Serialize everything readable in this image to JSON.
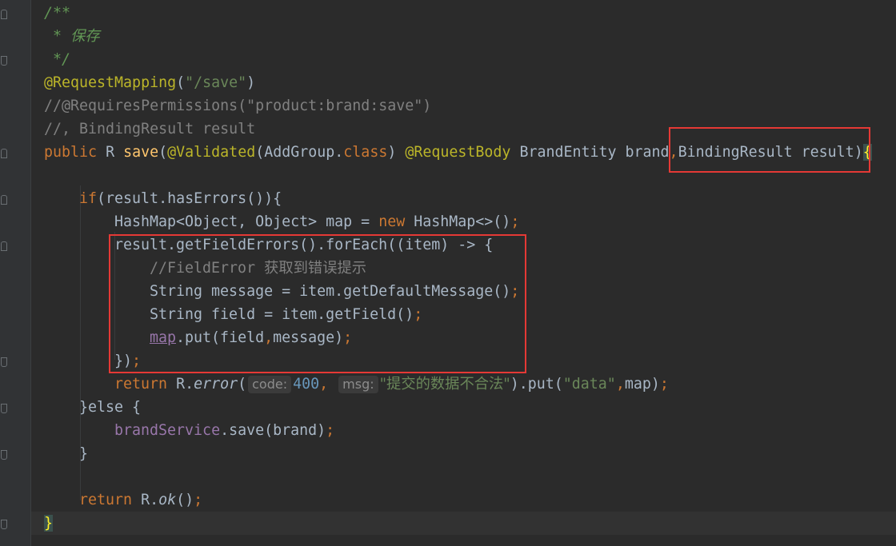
{
  "code": {
    "doc_open": "/**",
    "doc_text": " * 保存",
    "doc_close": " */",
    "ann_mapping": "@RequestMapping",
    "mapping_path": "\"/save\"",
    "comment_perms": "//@RequiresPermissions(\"product:brand:save\")",
    "comment_binding": "//, BindingResult result",
    "kw_public": "public",
    "type_r": "R",
    "method_save": "save",
    "ann_validated": "@Validated",
    "addgroup": "AddGroup",
    "kw_class": "class",
    "ann_requestbody": "@RequestBody",
    "brand_param": "BrandEntity brand",
    "binding_param": "BindingResult result",
    "kw_if": "if",
    "cond": "result.hasErrors()",
    "hashmap_decl": "HashMap<Object, Object> map = ",
    "kw_new": "new",
    "hashmap_ctor": "HashMap<>()",
    "foreach_line": "result.getFieldErrors().forEach((item) -> {",
    "comment_fielderror": "//FieldError 获取到错误提示",
    "message_line": "String message = item.getDefaultMessage()",
    "field_line": "String field = item.getField()",
    "map_var": "map",
    "put_call": ".put(field",
    "put_arg2": "message)",
    "close_lambda": "})",
    "kw_return": "return",
    "r_prefix": "R.",
    "error_fn": "error",
    "hint_code": "code:",
    "num_400": "400",
    "hint_msg": "msg:",
    "msg_str": "\"提交的数据不合法\"",
    "put_data": ").put(",
    "data_str": "\"data\"",
    "map_close": "map)",
    "kw_else": "}else {",
    "service_var": "brandService",
    "service_call": ".save(brand)",
    "close_brace": "}",
    "ok_fn": "ok",
    "ok_call": "()",
    "final_brace": "}"
  }
}
